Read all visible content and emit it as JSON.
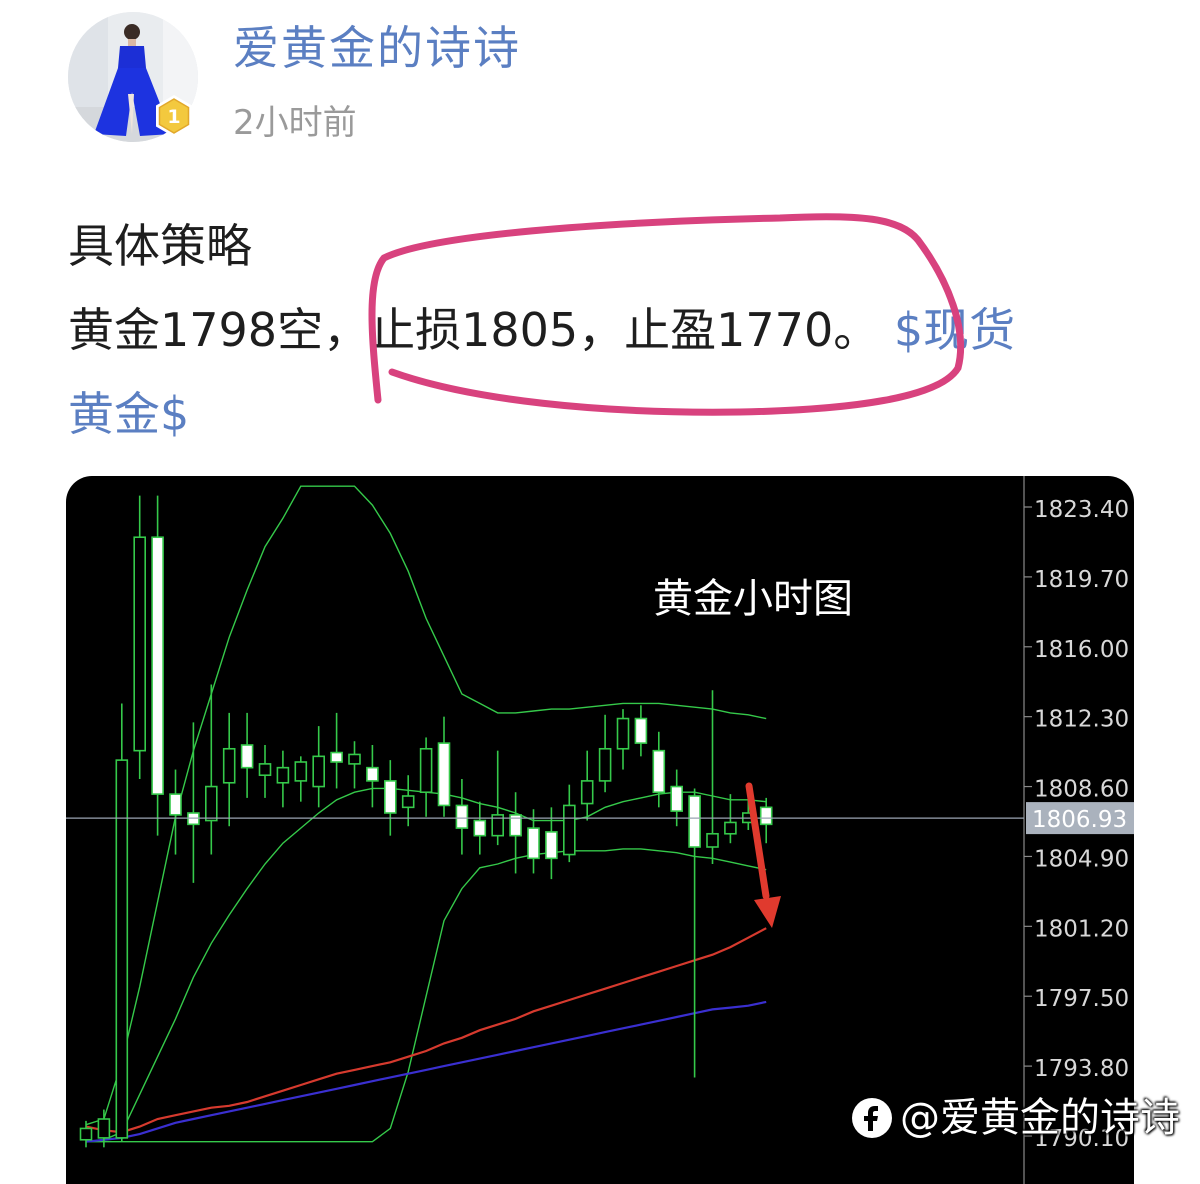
{
  "author": {
    "name": "爱黄金的诗诗",
    "time": "2小时前",
    "level_badge": "1",
    "avatar_icon": "avatar-woman-in-blue-dress"
  },
  "post": {
    "line1": "具体策略",
    "line2_a": "黄金1798空，",
    "line2_b": "止损1805，止盈1770。",
    "hashtag_part1": "$现货",
    "hashtag_part2": "黄金$"
  },
  "chart_data": {
    "type": "candlestick",
    "title": "黄金小时图",
    "y_ticks": [
      "1823.40",
      "1819.70",
      "1816.00",
      "1812.30",
      "1808.60",
      "1804.90",
      "1801.20",
      "1797.50",
      "1793.80",
      "1790.10"
    ],
    "current_price": "1806.93",
    "ylim": [
      1789.8,
      1824.5
    ],
    "candles": [
      {
        "o": 1789.9,
        "h": 1790.9,
        "l": 1789.5,
        "c": 1790.5
      },
      {
        "o": 1790.0,
        "h": 1791.5,
        "l": 1789.5,
        "c": 1791.0
      },
      {
        "o": 1790.0,
        "h": 1813.0,
        "l": 1789.8,
        "c": 1810.0
      },
      {
        "o": 1810.5,
        "h": 1824.0,
        "l": 1809.0,
        "c": 1821.8
      },
      {
        "o": 1821.8,
        "h": 1824.0,
        "l": 1806.0,
        "c": 1808.2
      },
      {
        "o": 1808.2,
        "h": 1809.5,
        "l": 1805.0,
        "c": 1807.1
      },
      {
        "o": 1807.2,
        "h": 1812.0,
        "l": 1803.5,
        "c": 1806.6
      },
      {
        "o": 1806.8,
        "h": 1814.0,
        "l": 1805.0,
        "c": 1808.6
      },
      {
        "o": 1808.8,
        "h": 1812.5,
        "l": 1806.5,
        "c": 1810.6
      },
      {
        "o": 1810.8,
        "h": 1812.5,
        "l": 1808.0,
        "c": 1809.6
      },
      {
        "o": 1809.2,
        "h": 1810.8,
        "l": 1808.0,
        "c": 1809.8
      },
      {
        "o": 1808.8,
        "h": 1810.5,
        "l": 1807.5,
        "c": 1809.6
      },
      {
        "o": 1808.9,
        "h": 1810.2,
        "l": 1807.8,
        "c": 1809.9
      },
      {
        "o": 1808.6,
        "h": 1811.8,
        "l": 1807.5,
        "c": 1810.2
      },
      {
        "o": 1810.4,
        "h": 1812.5,
        "l": 1808.5,
        "c": 1809.9
      },
      {
        "o": 1809.8,
        "h": 1811.0,
        "l": 1808.5,
        "c": 1810.3
      },
      {
        "o": 1809.6,
        "h": 1810.8,
        "l": 1807.5,
        "c": 1808.9
      },
      {
        "o": 1808.9,
        "h": 1810.0,
        "l": 1806.0,
        "c": 1807.2
      },
      {
        "o": 1807.5,
        "h": 1809.2,
        "l": 1806.5,
        "c": 1808.1
      },
      {
        "o": 1808.3,
        "h": 1811.2,
        "l": 1807.0,
        "c": 1810.6
      },
      {
        "o": 1810.9,
        "h": 1812.3,
        "l": 1807.0,
        "c": 1807.6
      },
      {
        "o": 1807.6,
        "h": 1809.0,
        "l": 1805.0,
        "c": 1806.4
      },
      {
        "o": 1806.8,
        "h": 1807.8,
        "l": 1805.0,
        "c": 1806.0
      },
      {
        "o": 1806.0,
        "h": 1810.5,
        "l": 1805.5,
        "c": 1807.1
      },
      {
        "o": 1807.1,
        "h": 1808.3,
        "l": 1804.0,
        "c": 1806.0
      },
      {
        "o": 1806.4,
        "h": 1807.4,
        "l": 1804.0,
        "c": 1804.8
      },
      {
        "o": 1806.2,
        "h": 1807.5,
        "l": 1803.7,
        "c": 1804.8
      },
      {
        "o": 1805.0,
        "h": 1808.7,
        "l": 1804.6,
        "c": 1807.6
      },
      {
        "o": 1807.7,
        "h": 1810.5,
        "l": 1806.8,
        "c": 1808.9
      },
      {
        "o": 1808.9,
        "h": 1812.4,
        "l": 1808.3,
        "c": 1810.6
      },
      {
        "o": 1810.6,
        "h": 1812.7,
        "l": 1809.5,
        "c": 1812.2
      },
      {
        "o": 1812.2,
        "h": 1812.9,
        "l": 1810.2,
        "c": 1810.9
      },
      {
        "o": 1810.5,
        "h": 1811.5,
        "l": 1807.5,
        "c": 1808.3
      },
      {
        "o": 1808.6,
        "h": 1809.5,
        "l": 1806.5,
        "c": 1807.3
      },
      {
        "o": 1808.1,
        "h": 1808.5,
        "l": 1793.2,
        "c": 1805.4
      },
      {
        "o": 1805.4,
        "h": 1813.7,
        "l": 1804.5,
        "c": 1806.1
      },
      {
        "o": 1806.1,
        "h": 1808.2,
        "l": 1805.6,
        "c": 1806.7
      },
      {
        "o": 1806.7,
        "h": 1808.5,
        "l": 1806.3,
        "c": 1807.2
      },
      {
        "o": 1807.5,
        "h": 1808.0,
        "l": 1805.6,
        "c": 1806.6
      }
    ],
    "series": [
      {
        "color": "#35c94a",
        "values": [
          1789.8,
          1789.9,
          1790.3,
          1792.3,
          1794.3,
          1796.3,
          1798.5,
          1800.3,
          1801.8,
          1803.2,
          1804.5,
          1805.6,
          1806.4,
          1807.2,
          1807.9,
          1808.3,
          1808.5,
          1808.5,
          1808.4,
          1808.3,
          1808.2,
          1808.0,
          1807.7,
          1807.5,
          1807.2,
          1806.8,
          1806.8,
          1806.8,
          1807.0,
          1807.5,
          1807.8,
          1808.0,
          1808.2,
          1808.3,
          1808.3,
          1808.1,
          1807.9,
          1807.9,
          1807.8
        ]
      },
      {
        "color": "#35c94a",
        "values": [
          1790.7,
          1791.0,
          1794.0,
          1798.0,
          1802.5,
          1807.0,
          1810.5,
          1813.5,
          1816.5,
          1819.0,
          1821.3,
          1822.8,
          1824.5,
          1824.5,
          1824.5,
          1824.5,
          1823.5,
          1822.0,
          1820.0,
          1817.5,
          1815.5,
          1813.5,
          1813.0,
          1812.5,
          1812.5,
          1812.6,
          1812.7,
          1812.7,
          1812.8,
          1812.9,
          1813.0,
          1813.0,
          1813.0,
          1812.9,
          1812.8,
          1812.7,
          1812.5,
          1812.4,
          1812.2
        ]
      },
      {
        "color": "#35c94a",
        "values": [
          1789.8,
          1789.8,
          1789.8,
          1789.8,
          1789.8,
          1789.8,
          1789.8,
          1789.8,
          1789.8,
          1789.8,
          1789.8,
          1789.8,
          1789.8,
          1789.8,
          1789.8,
          1789.8,
          1789.8,
          1790.5,
          1793.5,
          1797.5,
          1801.5,
          1803.2,
          1804.3,
          1804.5,
          1804.8,
          1805.0,
          1805.1,
          1805.2,
          1805.2,
          1805.2,
          1805.3,
          1805.3,
          1805.2,
          1805.1,
          1804.9,
          1804.8,
          1804.6,
          1804.4,
          1804.2
        ]
      },
      {
        "color": "#d63a2e",
        "values": [
          1790.6,
          1790.4,
          1790.3,
          1790.6,
          1791.0,
          1791.2,
          1791.4,
          1791.6,
          1791.7,
          1791.9,
          1792.2,
          1792.5,
          1792.8,
          1793.1,
          1793.4,
          1793.6,
          1793.8,
          1794.0,
          1794.3,
          1794.6,
          1795.0,
          1795.3,
          1795.7,
          1796.0,
          1796.3,
          1796.7,
          1797.0,
          1797.3,
          1797.6,
          1797.9,
          1798.2,
          1798.5,
          1798.8,
          1799.1,
          1799.4,
          1799.7,
          1800.1,
          1800.6,
          1801.1
        ]
      },
      {
        "color": "#3a2fd0",
        "values": [
          1789.8,
          1789.9,
          1790.0,
          1790.2,
          1790.5,
          1790.8,
          1791.0,
          1791.2,
          1791.4,
          1791.6,
          1791.8,
          1792.0,
          1792.2,
          1792.4,
          1792.6,
          1792.8,
          1793.0,
          1793.2,
          1793.4,
          1793.6,
          1793.8,
          1794.0,
          1794.2,
          1794.4,
          1794.6,
          1794.8,
          1795.0,
          1795.2,
          1795.4,
          1795.6,
          1795.8,
          1796.0,
          1796.2,
          1796.4,
          1796.6,
          1796.8,
          1796.9,
          1797.0,
          1797.2
        ]
      }
    ]
  },
  "watermark": {
    "text": "@爱黄金的诗诗",
    "icon": "toutiao-logo-icon"
  }
}
